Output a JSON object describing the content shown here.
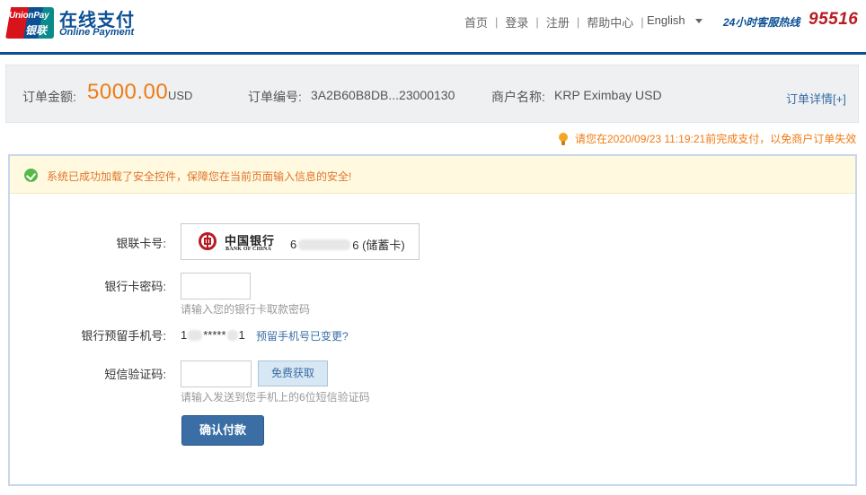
{
  "header": {
    "logo": {
      "line1": "UnionPay",
      "line2": "银联"
    },
    "brand_title": "在线支付",
    "brand_subtitle": "Online Payment",
    "nav": [
      {
        "label": "首页"
      },
      {
        "label": "登录"
      },
      {
        "label": "注册"
      },
      {
        "label": "帮助中心"
      }
    ],
    "language": "English",
    "hotline_label": "24小时客服热线",
    "hotline_number": "95516"
  },
  "order": {
    "amount_label": "订单金额:",
    "amount": "5000.00",
    "currency": "USD",
    "number_label": "订单编号:",
    "number": "3A2B60B8DB...23000130",
    "merchant_label": "商户名称:",
    "merchant": "KRP Eximbay USD",
    "details_link": "订单详情[+]"
  },
  "deadline_text": "请您在2020/09/23 11:19:21前完成支付，以免商户订单失效",
  "notice_text": "系统已成功加载了安全控件，保障您在当前页面输入信息的安全!",
  "form": {
    "card_label": "银联卡号:",
    "bank_name_cn": "中国银行",
    "bank_name_en": "BANK OF CHINA",
    "card_number_start": "6",
    "card_number_end": "6 (储蓄卡)",
    "password_label": "银行卡密码:",
    "password_value": "",
    "password_hint": "请输入您的银行卡取款密码",
    "phone_label": "银行预留手机号:",
    "phone_start": "1",
    "phone_middle": "*****",
    "phone_end": "1",
    "phone_change_link": "预留手机号已变更?",
    "sms_label": "短信验证码:",
    "sms_value": "",
    "sms_button": "免费获取",
    "sms_hint": "请输入发送到您手机上的6位短信验证码",
    "confirm_button": "确认付款"
  },
  "colors": {
    "brand_blue": "#0b4f94",
    "accent_orange": "#f07b13",
    "link_blue": "#3a6ea5",
    "success_green": "#56b947",
    "hotline_red": "#b81c22"
  }
}
